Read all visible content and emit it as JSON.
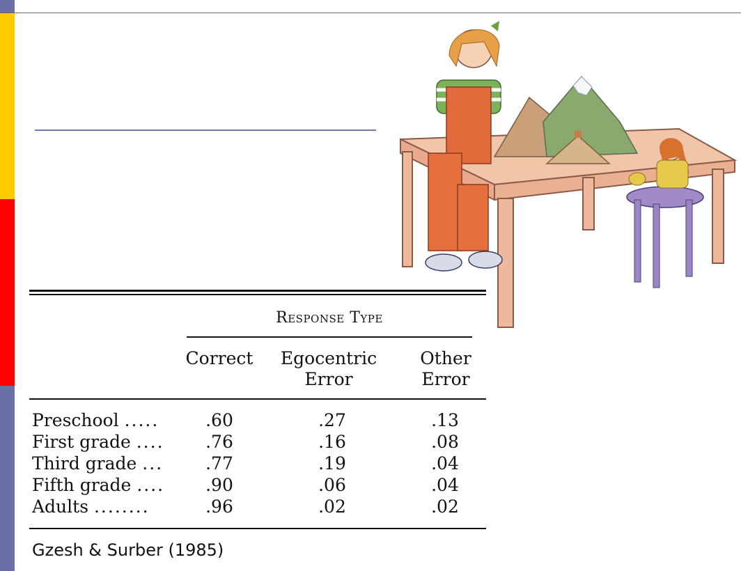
{
  "table": {
    "group_header": "Response Type",
    "columns": [
      {
        "line1": "",
        "line2": "Correct"
      },
      {
        "line1": "Egocentric",
        "line2": "Error"
      },
      {
        "line1": "Other",
        "line2": "Error"
      }
    ],
    "rows": [
      {
        "label": "Preschool",
        "leader": ".....",
        "values": [
          ".60",
          ".27",
          ".13"
        ]
      },
      {
        "label": "First grade",
        "leader": "....",
        "values": [
          ".76",
          ".16",
          ".08"
        ]
      },
      {
        "label": "Third grade",
        "leader": "...",
        "values": [
          ".77",
          ".19",
          ".04"
        ]
      },
      {
        "label": "Fifth grade",
        "leader": "....",
        "values": [
          ".90",
          ".06",
          ".04"
        ]
      },
      {
        "label": "Adults",
        "leader": "........",
        "values": [
          ".96",
          ".02",
          ".02"
        ]
      }
    ]
  },
  "citation": "Gzesh & Surber (1985)",
  "colors": {
    "stripe_yellow": "#ffcc00",
    "stripe_red": "#ff0000",
    "stripe_purple": "#6b6ea8",
    "title_rule": "#6b7aa0"
  }
}
